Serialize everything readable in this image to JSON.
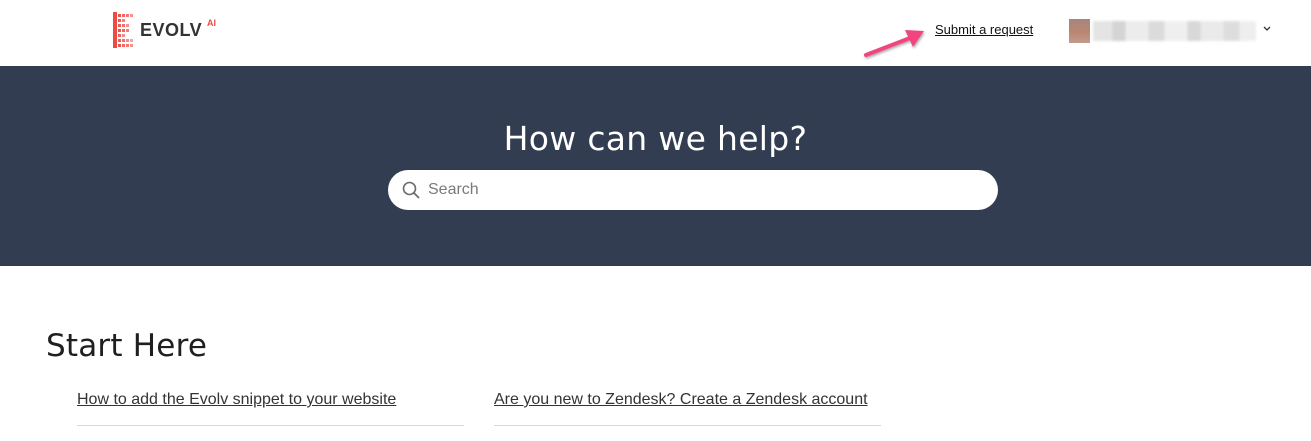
{
  "header": {
    "logo": {
      "text": "EVOLV",
      "suffix": "AI",
      "brand_color": "#ee4a44"
    },
    "submit_request_label": "Submit a request",
    "user_menu": {
      "avatar": "user-avatar",
      "name_obscured": true,
      "chevron_icon": "chevron-down-icon"
    },
    "annotation": {
      "icon": "arrow-annotation-icon",
      "color": "#f0457f"
    }
  },
  "hero": {
    "background_color": "#323d51",
    "title": "How can we help?",
    "search": {
      "placeholder": "Search",
      "icon": "search-icon"
    }
  },
  "section": {
    "title": "Start Here",
    "articles": [
      {
        "label": "How to add the Evolv snippet to your website"
      },
      {
        "label": "Are you new to Zendesk? Create a Zendesk account"
      }
    ]
  }
}
